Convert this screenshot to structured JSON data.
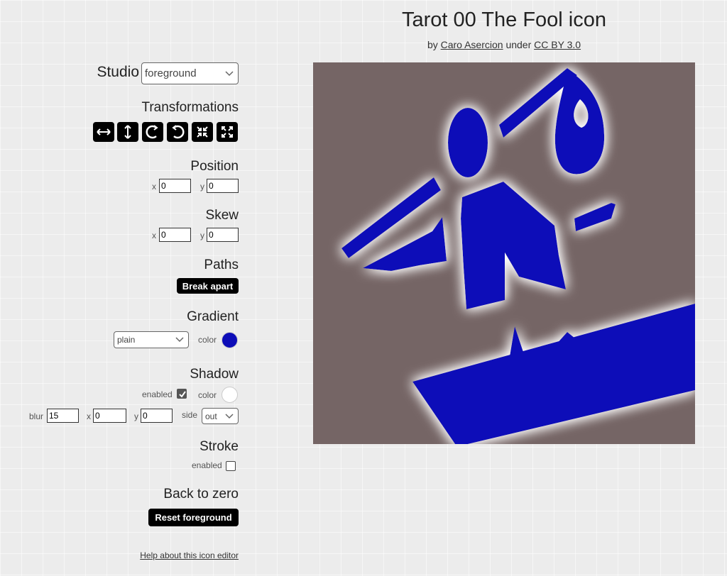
{
  "header": {
    "title": "Tarot 00 The Fool icon",
    "by": "by",
    "author": "Caro Asercion",
    "under": "under",
    "license": "CC BY 3.0"
  },
  "panel": {
    "studio_label": "Studio",
    "studio_value": "foreground",
    "transformations_label": "Transformations",
    "transform_icons": [
      "flip-horizontal-icon",
      "flip-vertical-icon",
      "rotate-clockwise-icon",
      "rotate-counterclockwise-icon",
      "shrink-icon",
      "expand-icon"
    ],
    "position_label": "Position",
    "position_x_label": "x",
    "position_x": "0",
    "position_y_label": "y",
    "position_y": "0",
    "skew_label": "Skew",
    "skew_x_label": "x",
    "skew_x": "0",
    "skew_y_label": "y",
    "skew_y": "0",
    "paths_label": "Paths",
    "break_apart": "Break apart",
    "gradient_label": "Gradient",
    "gradient_value": "plain",
    "gradient_color_label": "color",
    "gradient_color": "#0d0db8",
    "shadow_label": "Shadow",
    "shadow_enabled_label": "enabled",
    "shadow_enabled": true,
    "shadow_color_label": "color",
    "shadow_color": "#ffffff",
    "blur_label": "blur",
    "blur_value": "15",
    "shadow_x_label": "x",
    "shadow_x": "0",
    "shadow_y_label": "y",
    "shadow_y": "0",
    "side_label": "side",
    "side_value": "out",
    "stroke_label": "Stroke",
    "stroke_enabled_label": "enabled",
    "stroke_enabled": false,
    "back_to_zero_label": "Back to zero",
    "reset_button": "Reset foreground",
    "help_link": "Help about this icon editor"
  },
  "preview": {
    "background_color": "#756565",
    "icon_color": "#0d0db8",
    "glow_color": "#ffffff"
  }
}
